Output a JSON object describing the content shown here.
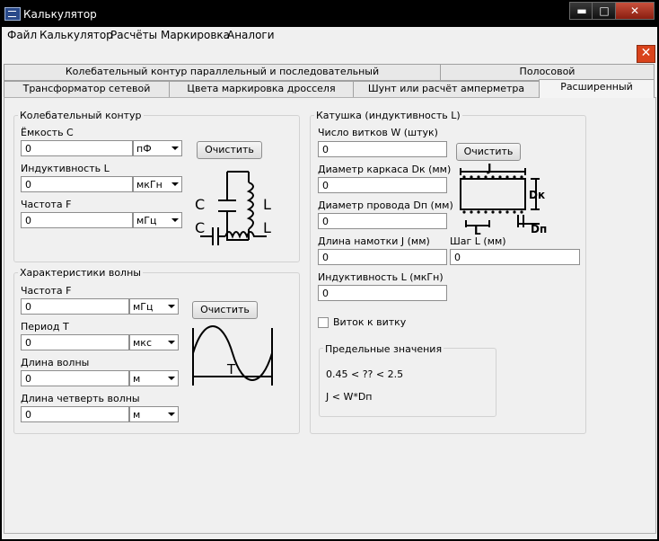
{
  "window": {
    "title": "Калькулятор",
    "min": "▬",
    "max": "□",
    "close": "✕"
  },
  "menu": [
    "Файл",
    "Калькулятор",
    "Расчёты",
    "Маркировка",
    "Аналоги"
  ],
  "close_box": "✕",
  "tabs_row1": [
    "Колебательный контур параллельный и последовательный",
    "Полосовой"
  ],
  "tabs_row2": [
    "Трансформатор сетевой",
    "Цвета маркировка дросселя",
    "Шунт или расчёт амперметра",
    "Расширенный"
  ],
  "oscillator": {
    "title": "Колебательный контур",
    "c_label": "Ёмкость С",
    "c_value": "0",
    "c_unit": "пФ",
    "l_label": "Индуктивность L",
    "l_value": "0",
    "l_unit": "мкГн",
    "f_label": "Частота F",
    "f_value": "0",
    "f_unit": "мГц",
    "clear": "Очистить",
    "diagram": {
      "c1": "C",
      "l1": "L",
      "c2": "C",
      "l2": "L"
    }
  },
  "wave": {
    "title": "Характеристики волны",
    "f_label": "Частота F",
    "f_value": "0",
    "f_unit": "мГц",
    "t_label": "Период T",
    "t_value": "0",
    "t_unit": "мкс",
    "len_label": "Длина волны",
    "len_value": "0",
    "len_unit": "м",
    "q_label": "Длина четверть волны",
    "q_value": "0",
    "q_unit": "м",
    "clear": "Очистить",
    "diagram_t": "T"
  },
  "coil": {
    "title": "Катушка (индуктивность L)",
    "w_label": "Число витков W (штук)",
    "w_value": "0",
    "clear": "Очистить",
    "dk_label": "Диаметр каркаса Dк (мм)",
    "dk_value": "0",
    "dp_label": "Диаметр провода Dп (мм)",
    "dp_value": "0",
    "j_label": "Длина намотки J (мм)",
    "j_value": "0",
    "step_label": "Шаг L (мм)",
    "step_value": "0",
    "ind_label": "Индуктивность L (мкГн)",
    "ind_value": "0",
    "turn_label": "Виток к витку",
    "diagram": {
      "j": "J",
      "dk": "Dк",
      "l": "L",
      "dp": "Dп"
    }
  },
  "limits": {
    "title": "Предельные значения",
    "line1": "0.45 < ?? < 2.5",
    "line2": "J < W*Dп"
  }
}
